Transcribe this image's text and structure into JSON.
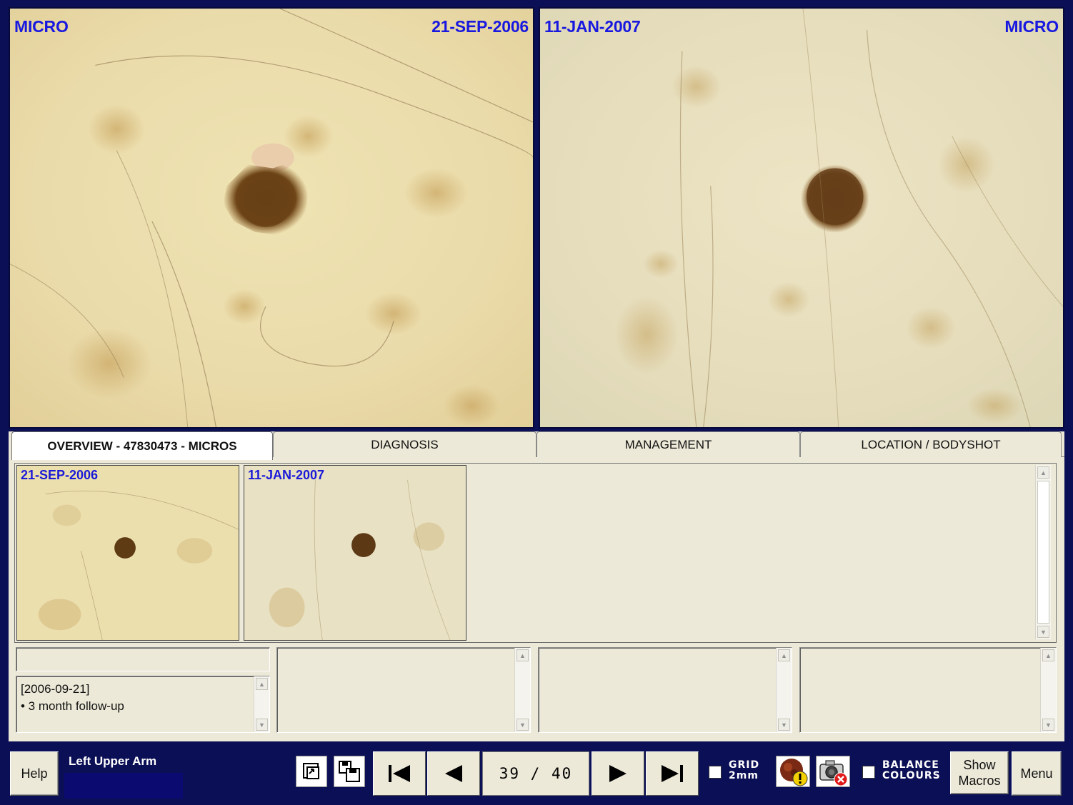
{
  "images": {
    "left": {
      "type_label": "MICRO",
      "date_label": "21-SEP-2006"
    },
    "right": {
      "date_label": "11-JAN-2007",
      "type_label": "MICRO"
    }
  },
  "tabs": [
    {
      "label": "OVERVIEW  -  47830473 - MICROS",
      "active": true
    },
    {
      "label": "DIAGNOSIS",
      "active": false
    },
    {
      "label": "MANAGEMENT",
      "active": false
    },
    {
      "label": "LOCATION / BODYSHOT",
      "active": false
    }
  ],
  "thumbnails": [
    {
      "date": "21-SEP-2006"
    },
    {
      "date": "11-JAN-2007"
    }
  ],
  "notes": {
    "date": "[2006-09-21]",
    "item": "• 3 month follow-up"
  },
  "toolbar": {
    "help_label": "Help",
    "location": "Left Upper Arm",
    "counter": "39 / 40",
    "grid_label_line1": "GRID",
    "grid_label_line2": "2mm",
    "balance_label_line1": "BALANCE",
    "balance_label_line2": "COLOURS",
    "show_macros_line1": "Show",
    "show_macros_line2": "Macros",
    "menu_label": "Menu"
  },
  "icons": {
    "first": "skip-first-icon",
    "prev": "prev-icon",
    "next": "next-icon",
    "last": "skip-last-icon",
    "lesion_warning": "lesion-warning-icon",
    "camera_delete": "camera-delete-icon",
    "restore_window": "restore-window-icon",
    "copy_window": "copy-window-icon"
  },
  "colors": {
    "frame": "#0b0f55",
    "label_blue": "#1818e0",
    "panel": "#ece9d8"
  }
}
